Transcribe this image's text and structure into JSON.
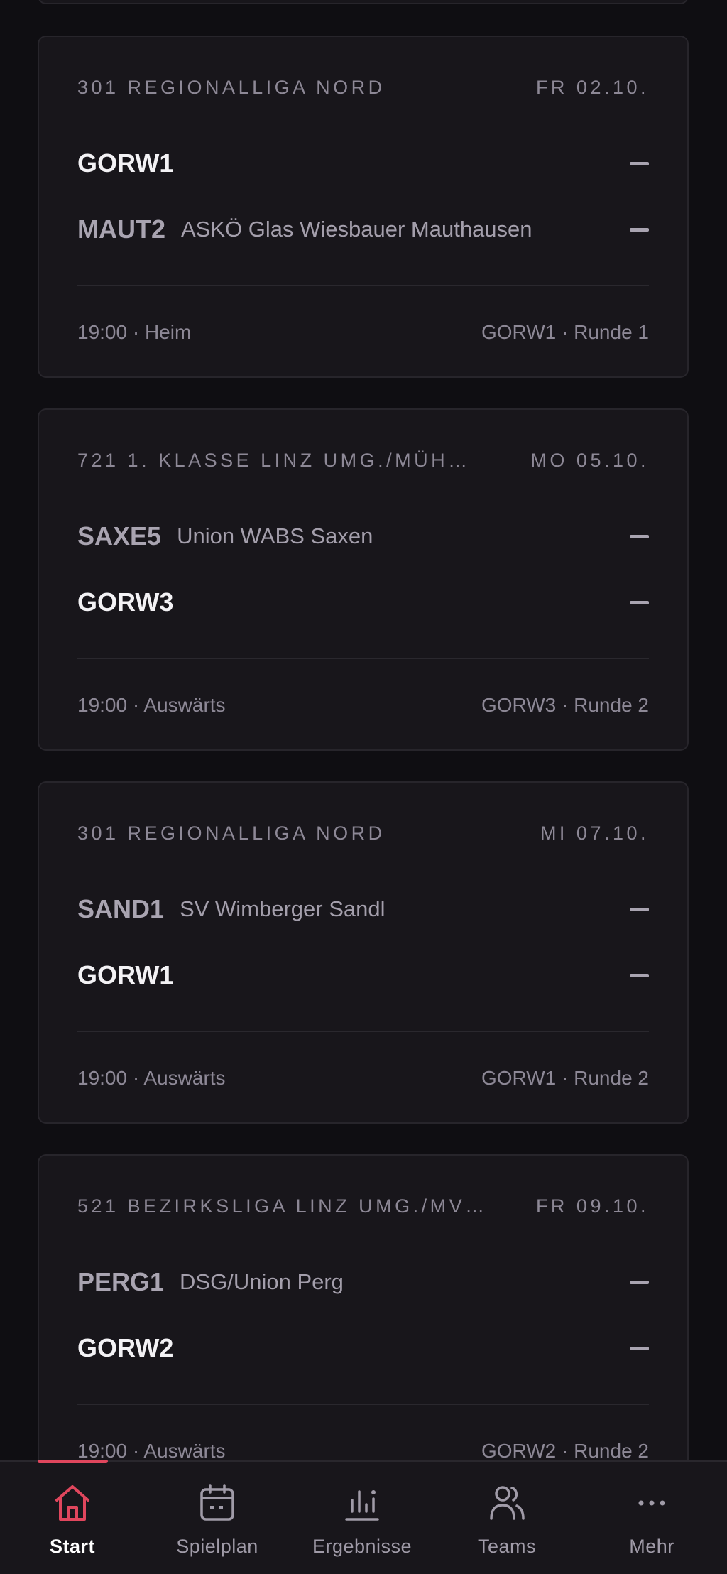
{
  "matches": [
    {
      "league": "301 REGIONALLIGA NORD",
      "date": "FR 02.10.",
      "rows": [
        {
          "code": "GORW1",
          "name": "",
          "own": true,
          "score": "–"
        },
        {
          "code": "MAUT2",
          "name": "ASKÖ Glas Wiesbauer Mauthausen",
          "own": false,
          "score": "–"
        }
      ],
      "time_venue": "19:00 · Heim",
      "round": "GORW1 · Runde 1"
    },
    {
      "league": "721 1. KLASSE LINZ UMG./MÜH…",
      "date": "MO 05.10.",
      "rows": [
        {
          "code": "SAXE5",
          "name": "Union WABS Saxen",
          "own": false,
          "score": "–"
        },
        {
          "code": "GORW3",
          "name": "",
          "own": true,
          "score": "–"
        }
      ],
      "time_venue": "19:00 · Auswärts",
      "round": "GORW3 · Runde 2"
    },
    {
      "league": "301 REGIONALLIGA NORD",
      "date": "MI 07.10.",
      "rows": [
        {
          "code": "SAND1",
          "name": "SV Wimberger Sandl",
          "own": false,
          "score": "–"
        },
        {
          "code": "GORW1",
          "name": "",
          "own": true,
          "score": "–"
        }
      ],
      "time_venue": "19:00 · Auswärts",
      "round": "GORW1 · Runde 2"
    },
    {
      "league": "521 BEZIRKSLIGA LINZ UMG./MV…",
      "date": "FR 09.10.",
      "rows": [
        {
          "code": "PERG1",
          "name": "DSG/Union Perg",
          "own": false,
          "score": "–"
        },
        {
          "code": "GORW2",
          "name": "",
          "own": true,
          "score": "–"
        }
      ],
      "time_venue": "19:00 · Auswärts",
      "round": "GORW2 · Runde 2"
    }
  ],
  "nav": {
    "active": "start",
    "items": [
      {
        "id": "start",
        "label": "Start",
        "icon": "home-icon"
      },
      {
        "id": "spielplan",
        "label": "Spielplan",
        "icon": "calendar-icon"
      },
      {
        "id": "ergebnisse",
        "label": "Ergebnisse",
        "icon": "results-chart-icon"
      },
      {
        "id": "teams",
        "label": "Teams",
        "icon": "teams-icon"
      },
      {
        "id": "mehr",
        "label": "Mehr",
        "icon": "more-dots-icon"
      }
    ]
  },
  "colors": {
    "background": "#0f0e12",
    "card": "#18161b",
    "accent": "#e0465d",
    "own_team": "#f3f2f5",
    "opponent": "#a9a4b1",
    "muted": "#8d8896"
  }
}
